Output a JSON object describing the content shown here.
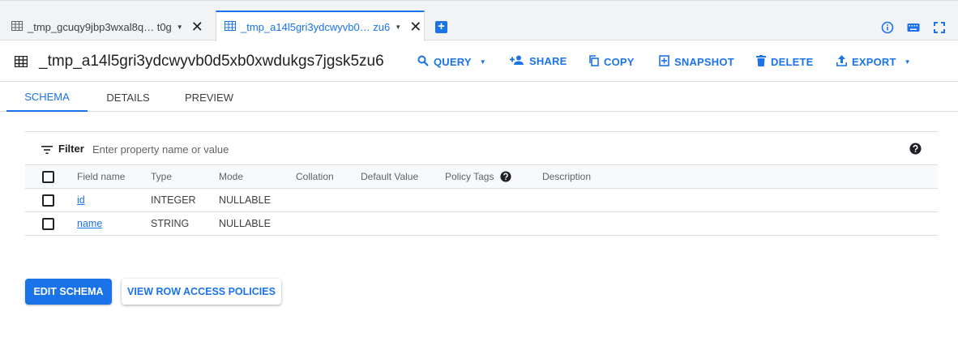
{
  "tabs": [
    {
      "label": "_tmp_gcuqy9jbp3wxal8q…  t0g"
    },
    {
      "label": "_tmp_a14l5gri3ydcwyvb0…  zu6"
    }
  ],
  "header": {
    "title": "_tmp_a14l5gri3ydcwyvb0d5xb0xwdukgs7jgsk5zu6",
    "actions": {
      "query": "QUERY",
      "share": "SHARE",
      "copy": "COPY",
      "snapshot": "SNAPSHOT",
      "delete": "DELETE",
      "export": "EXPORT"
    }
  },
  "subtabs": [
    "SCHEMA",
    "DETAILS",
    "PREVIEW"
  ],
  "filter": {
    "label": "Filter",
    "placeholder": "Enter property name or value"
  },
  "table": {
    "columns": [
      "Field name",
      "Type",
      "Mode",
      "Collation",
      "Default Value",
      "Policy Tags",
      "Description"
    ],
    "rows": [
      {
        "name": "id",
        "type": "INTEGER",
        "mode": "NULLABLE"
      },
      {
        "name": "name",
        "type": "STRING",
        "mode": "NULLABLE"
      }
    ]
  },
  "buttons": {
    "edit_schema": "EDIT SCHEMA",
    "row_access": "VIEW ROW ACCESS POLICIES"
  },
  "colors": {
    "accent": "#1a73e8"
  }
}
